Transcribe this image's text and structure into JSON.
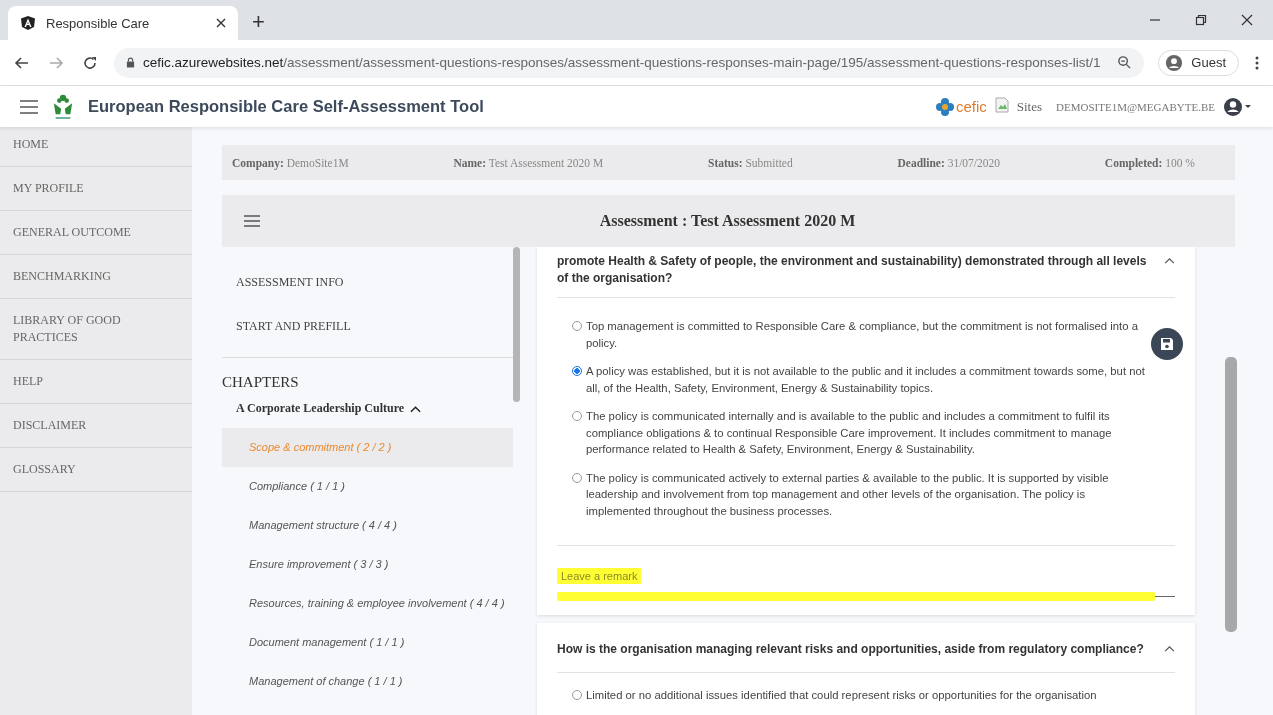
{
  "browser": {
    "tab_title": "Responsible Care",
    "new_tab": "+",
    "url_host": "cefic.azurewebsites.net",
    "url_path": "/assessment/assessment-questions-responses/assessment-questions-responses-main-page/195/assessment-questions-responses-list/1",
    "profile": "Guest"
  },
  "header": {
    "title": "European Responsible Care Self-Assessment Tool",
    "brand": "cefic",
    "sites": "Sites",
    "user": "DEMOSITE1M@MEGABYTE.BE"
  },
  "sidebar": {
    "items": [
      {
        "label": "HOME",
        "selected": false
      },
      {
        "label": "MY PROFILE",
        "selected": false
      },
      {
        "label": "GENERAL OUTCOME",
        "selected": false
      },
      {
        "label": "BENCHMARKING",
        "selected": false
      },
      {
        "label": "LIBRARY OF GOOD PRACTICES",
        "selected": false
      },
      {
        "label": "HELP",
        "selected": false
      },
      {
        "label": "DISCLAIMER",
        "selected": false
      },
      {
        "label": "GLOSSARY",
        "selected": false
      }
    ]
  },
  "info_bar": [
    {
      "label": "Company:",
      "value": "DemoSite1M"
    },
    {
      "label": "Name:",
      "value": "Test Assessment 2020 M"
    },
    {
      "label": "Status:",
      "value": "Submitted"
    },
    {
      "label": "Deadline:",
      "value": "31/07/2020"
    },
    {
      "label": "Completed:",
      "value": "100 %"
    }
  ],
  "assessment_title": "Assessment : Test Assessment 2020 M",
  "nav": {
    "links": [
      "ASSESSMENT INFO",
      "START AND PREFILL"
    ],
    "chapters_heading": "CHAPTERS",
    "chapter": {
      "title": "A Corporate Leadership Culture",
      "expanded": true,
      "sections": [
        {
          "label": "Scope & commitment ( 2 / 2 )",
          "selected": true
        },
        {
          "label": "Compliance ( 1 / 1 )",
          "selected": false
        },
        {
          "label": "Management structure ( 4 / 4 )",
          "selected": false
        },
        {
          "label": "Ensure improvement ( 3 / 3 )",
          "selected": false
        },
        {
          "label": "Resources, training & employee involvement ( 4 / 4 )",
          "selected": false
        },
        {
          "label": "Document management ( 1 / 1 )",
          "selected": false
        },
        {
          "label": "Management of change ( 1 / 1 )",
          "selected": false
        }
      ]
    }
  },
  "questions": [
    {
      "text": "promote Health & Safety of people, the environment and sustainability) demonstrated through all levels of the organisation?",
      "expanded": true,
      "options": [
        {
          "label": "Top management is committed to Responsible Care & compliance, but the commitment is not formalised into a policy.",
          "selected": false
        },
        {
          "label": "A policy was established, but it is not available to the public and it includes a commitment towards some, but not all, of the Health, Safety, Environment, Energy & Sustainability topics.",
          "selected": true
        },
        {
          "label": "The policy is communicated internally and is available to the public and includes a commitment to fulfil its compliance obligations & to continual Responsible Care improvement. It includes commitment to manage performance related to Health & Safety, Environment, Energy & Sustainability.",
          "selected": false
        },
        {
          "label": "The policy is communicated actively to external parties & available to the public. It is supported by visible leadership and involvement from top management and other levels of the organisation. The policy is implemented throughout the business processes.",
          "selected": false
        }
      ],
      "remark_placeholder": "Leave a remark",
      "highlighted": true
    },
    {
      "text": "How is the organisation managing relevant risks and opportunities, aside from regulatory compliance?",
      "expanded": true,
      "options": [
        {
          "label": "Limited or no additional issues identified that could represent risks or opportunities for the organisation",
          "selected": false
        }
      ]
    }
  ]
}
